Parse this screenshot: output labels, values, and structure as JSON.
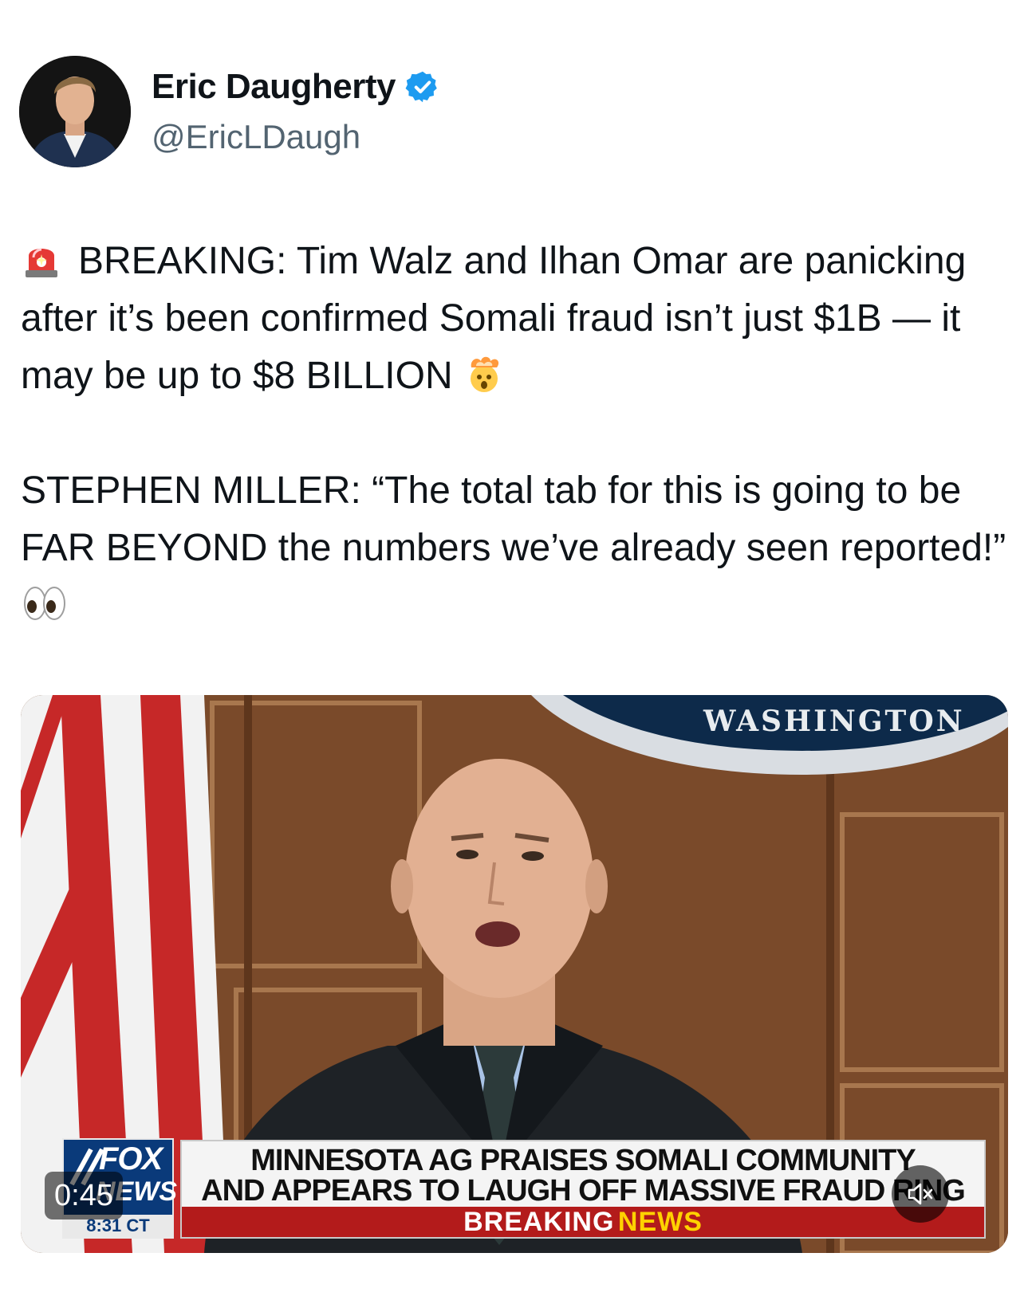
{
  "author": {
    "display_name": "Eric Daugherty",
    "handle": "@EricLDaugh",
    "verified": true
  },
  "tweet": {
    "paragraph_1": {
      "emoji_start": "rotating-light",
      "text": "BREAKING: Tim Walz and Ilhan Omar are panicking after it’s been confirmed Somali fraud isn’t just $1B — it may be up to $8 BILLION",
      "emoji_end": "exploding-head"
    },
    "paragraph_2": {
      "text": "STEPHEN MILLER: “The total tab for this is going to be FAR BEYOND the numbers we’ve already seen reported!”",
      "emoji_end": "eyes"
    }
  },
  "video": {
    "backdrop_text": "WASHINGTON",
    "chyron_line_1": "MINNESOTA AG PRAISES SOMALI COMMUNITY",
    "chyron_line_2": "AND APPEARS TO LAUGH OFF MASSIVE FRAUD RING",
    "breaking_label_1": "BREAKING",
    "breaking_label_2": "NEWS",
    "network_logo": {
      "word_1": "FOX",
      "word_2": "NEWS",
      "time": "8:31 CT"
    },
    "timestamp": "0:45",
    "muted": true,
    "colors": {
      "chyron_red": "#b31b1b",
      "breaking_yellow": "#ffd200",
      "fox_blue": "#0a3a7a"
    }
  },
  "colors": {
    "verified": "#1d9bf0",
    "handle": "#536471",
    "text": "#0f1419"
  }
}
